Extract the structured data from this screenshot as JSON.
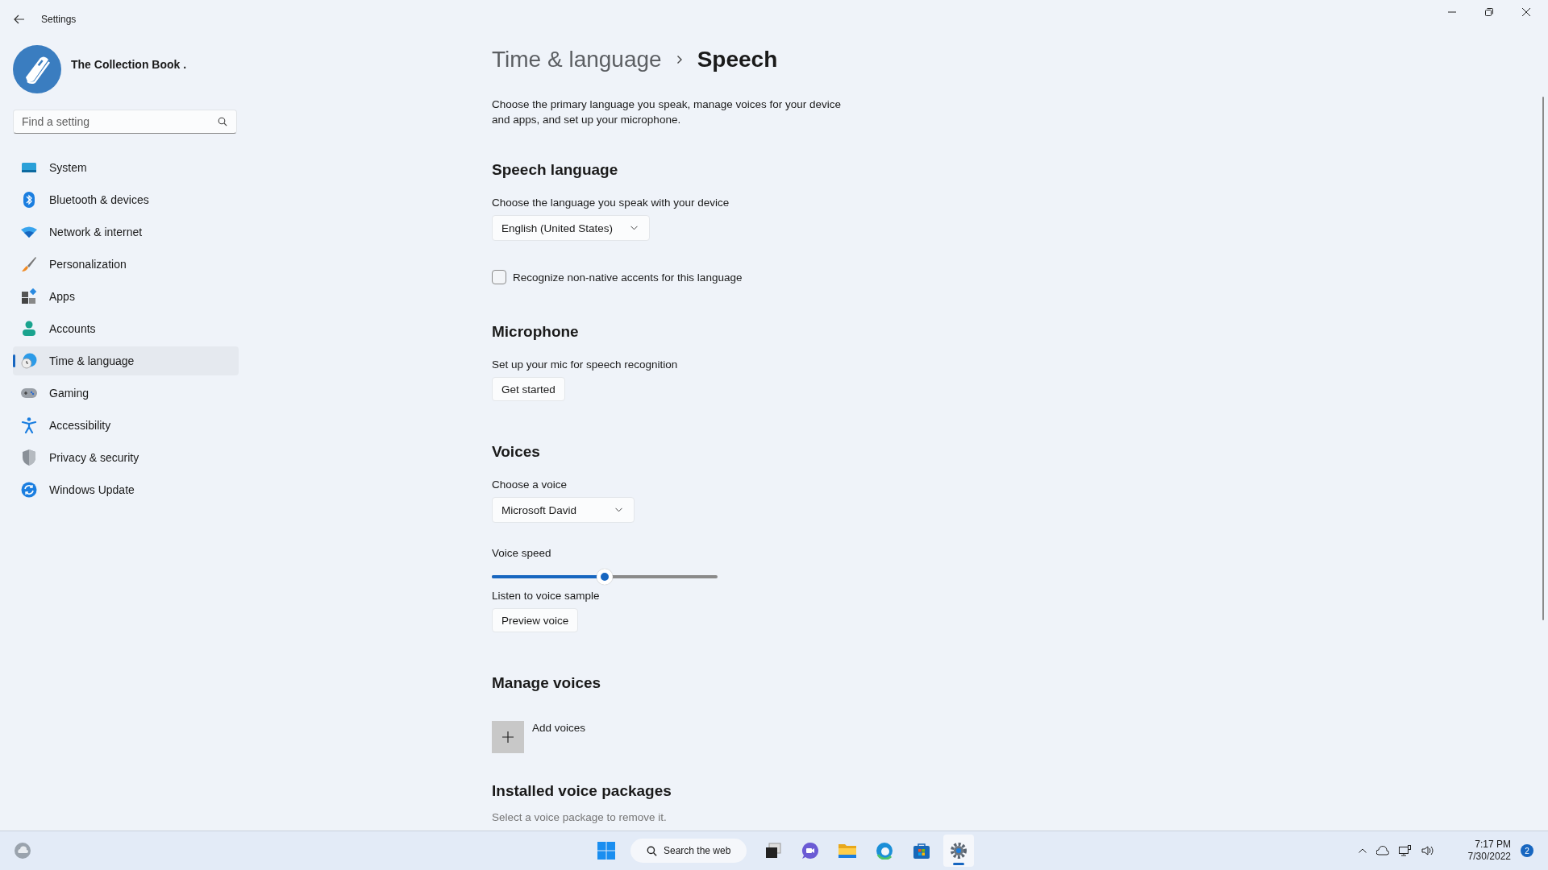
{
  "window": {
    "title": "Settings"
  },
  "profile": {
    "name": "The Collection Book ."
  },
  "search": {
    "placeholder": "Find a setting"
  },
  "nav": [
    {
      "label": "System",
      "selected": false
    },
    {
      "label": "Bluetooth & devices",
      "selected": false
    },
    {
      "label": "Network & internet",
      "selected": false
    },
    {
      "label": "Personalization",
      "selected": false
    },
    {
      "label": "Apps",
      "selected": false
    },
    {
      "label": "Accounts",
      "selected": false
    },
    {
      "label": "Time & language",
      "selected": true
    },
    {
      "label": "Gaming",
      "selected": false
    },
    {
      "label": "Accessibility",
      "selected": false
    },
    {
      "label": "Privacy & security",
      "selected": false
    },
    {
      "label": "Windows Update",
      "selected": false
    }
  ],
  "breadcrumb": {
    "parent": "Time & language",
    "current": "Speech"
  },
  "description": "Choose the primary language you speak, manage voices for your device and apps, and set up your microphone.",
  "sections": [
    {
      "title": "Speech language",
      "items": [
        {
          "kind": "label",
          "text": "Choose the language you speak with your device"
        },
        {
          "kind": "dropdown",
          "value": "English (United States)"
        },
        {
          "kind": "checkbox",
          "label": "Recognize non-native accents for this language",
          "checked": false
        }
      ]
    },
    {
      "title": "Microphone",
      "items": [
        {
          "kind": "label",
          "text": "Set up your mic for speech recognition"
        },
        {
          "kind": "button",
          "label": "Get started"
        }
      ]
    },
    {
      "title": "Voices",
      "items": [
        {
          "kind": "label",
          "text": "Choose a voice"
        },
        {
          "kind": "dropdown",
          "value": "Microsoft David"
        },
        {
          "kind": "label",
          "text": "Voice speed"
        },
        {
          "kind": "slider",
          "level": 0.5
        },
        {
          "kind": "label",
          "text": "Listen to voice sample"
        },
        {
          "kind": "button",
          "label": "Preview voice"
        }
      ]
    },
    {
      "title": "Manage voices",
      "items": [
        {
          "kind": "add",
          "label": "Add voices"
        }
      ]
    },
    {
      "title": "Installed voice packages",
      "items": [
        {
          "kind": "hint",
          "text": "Select a voice package to remove it."
        }
      ]
    }
  ],
  "taskbar": {
    "search": "Search the web",
    "apps": [
      {
        "active": false
      },
      {
        "active": false
      },
      {
        "active": false
      },
      {
        "active": false
      },
      {
        "active": false
      },
      {
        "active": true
      }
    ],
    "time": "7:17 PM",
    "date": "7/30/2022",
    "notifications": "2"
  }
}
